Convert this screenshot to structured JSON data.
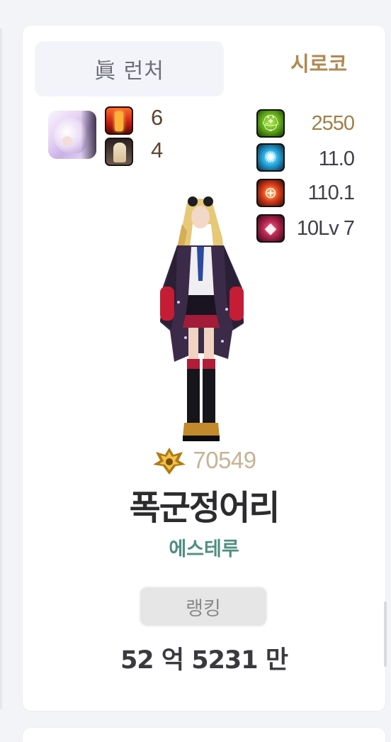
{
  "card": {
    "title": "眞 런처",
    "job_link": "시로코",
    "left_counts": {
      "a": "6",
      "b": "4"
    },
    "stats": [
      {
        "icon": "helmet-icon",
        "value": "2550",
        "color": "#a07f48"
      },
      {
        "icon": "swirl-icon",
        "value": "11.0",
        "color": "#3f3f46"
      },
      {
        "icon": "crosshair-icon",
        "value": "110.1",
        "color": "#3f3f46"
      },
      {
        "icon": "crystal-icon",
        "value": "10Lv 7",
        "color": "#3f3f46"
      }
    ],
    "fame": "70549",
    "character_name": "폭군정어리",
    "guild": "에스테루",
    "rank_button": "랭킹",
    "gold": "52 억 5231 만"
  }
}
